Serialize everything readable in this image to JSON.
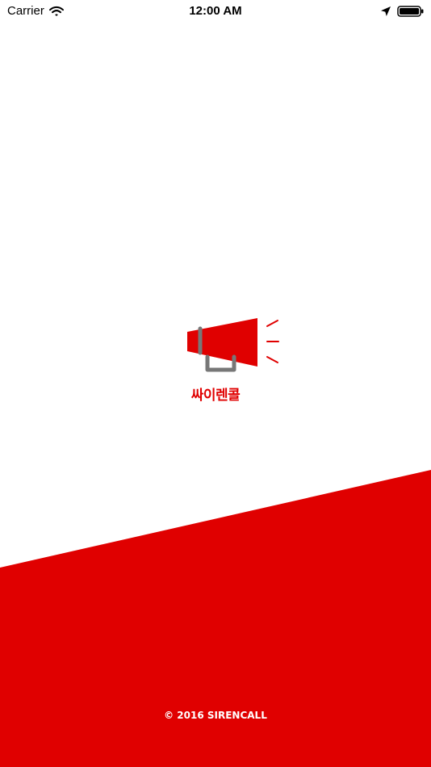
{
  "status_bar": {
    "carrier": "Carrier",
    "time": "12:00 AM",
    "icons": [
      "wifi-icon",
      "location-arrow-icon",
      "battery-icon"
    ]
  },
  "splash": {
    "app_name": "싸이렌콜",
    "logo_icon": "megaphone-icon",
    "copyright": "© 2016 SIRENCALL"
  },
  "colors": {
    "brand_red": "#e00000",
    "handle_gray": "#777777",
    "background": "#ffffff",
    "footer_text": "#ffffff"
  }
}
